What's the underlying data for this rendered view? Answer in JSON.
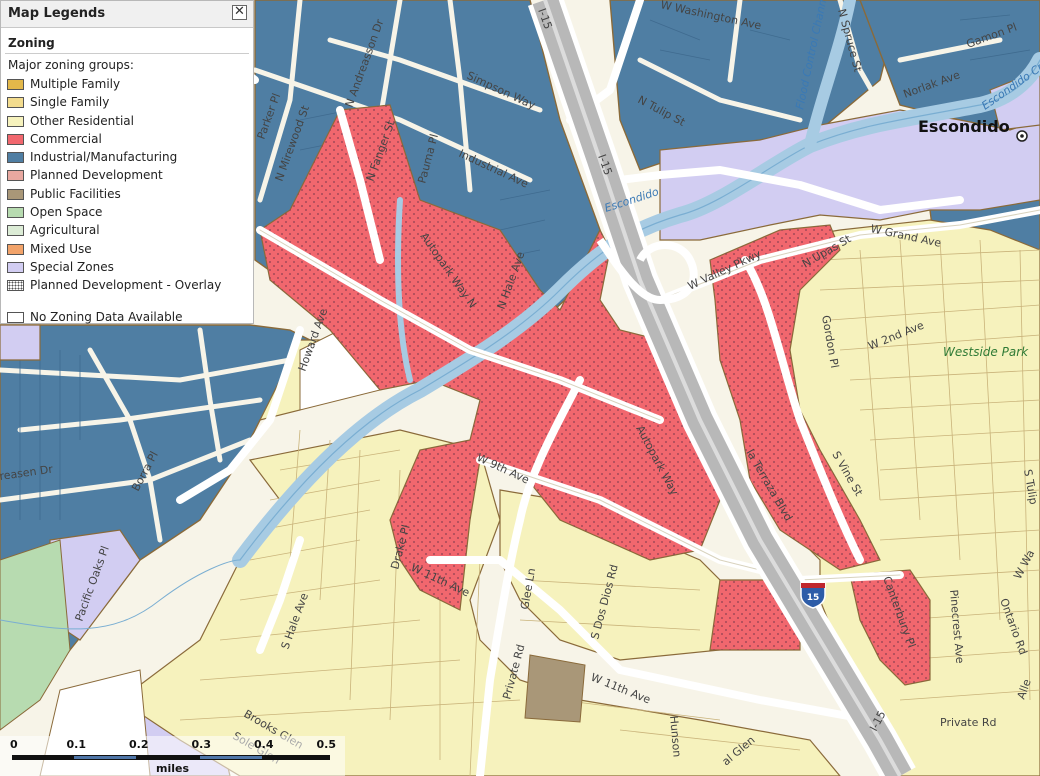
{
  "legend": {
    "title": "Map Legends",
    "close_glyph": "✕",
    "section": "Zoning",
    "subtitle": "Major zoning groups:",
    "items": [
      {
        "label": "Multiple Family",
        "color": "#e3b84a"
      },
      {
        "label": "Single Family",
        "color": "#f3dc8e"
      },
      {
        "label": "Other Residential",
        "color": "#f6f2bd"
      },
      {
        "label": "Commercial",
        "color": "#f1676e"
      },
      {
        "label": "Industrial/Manufacturing",
        "color": "#4f7ea3"
      },
      {
        "label": "Planned Development",
        "color": "#e8a8a0"
      },
      {
        "label": "Public Facilities",
        "color": "#a99778"
      },
      {
        "label": "Open Space",
        "color": "#b7dbb0"
      },
      {
        "label": "Agricultural",
        "color": "#dcecd6"
      },
      {
        "label": "Mixed Use",
        "color": "#f2a36a"
      },
      {
        "label": "Special Zones",
        "color": "#d2cdf2"
      },
      {
        "label": "Planned Development - Overlay",
        "color": "#ffffff"
      },
      {
        "label": "No Zoning Data Available",
        "color": "#ffffff"
      }
    ]
  },
  "map": {
    "city_label": "Escondido",
    "park_label": "Westside Park",
    "water_labels": [
      "Escondido",
      "Flood Control Channel",
      "Escondido Cre"
    ],
    "shield_label": "15",
    "road_labels": {
      "washington": "W Washington Ave",
      "simpson": "Simpson Way",
      "tulip": "N Tulip St",
      "industrial": "Industrial Ave",
      "andreasson": "N Andreasson Dr",
      "parker": "Parker Pl",
      "mirewood": "N Mirewood St",
      "fanger": "N Fanger St",
      "paumaPl": "Pauma Pl",
      "autoparkN": "Autopark Way N",
      "haleN": "N Hale Ave",
      "howard": "Howard Ave",
      "valley": "W Valley Pkwy",
      "grand": "W Grand Ave",
      "upas": "N Upas St",
      "gordon": "Gordon Pl",
      "second": "W 2nd Ave",
      "norlak": "Norlak Ave",
      "spruce": "N Spruce St",
      "gamon": "Gamon Pl",
      "i15a": "I-15",
      "i15b": "I-15",
      "i15c": "I-15",
      "ninth": "W 9th Ave",
      "autopark": "Autopark Way",
      "laTerraza": "la Terraza Blvd",
      "vine": "S Vine St",
      "eleventh1": "W 11th Ave",
      "eleventh2": "W 11th Ave",
      "canterbury": "Canterbury Pl",
      "pinecrest": "Pinecrest Ave",
      "ontario": "Ontario Rd",
      "privateRd1": "Private Rd",
      "privateRd2": "Private Rd",
      "gleeLn": "Glee Ln",
      "sanDiegos": "S Dos Dios Rd",
      "drakePl": "Drake Pl",
      "shale": "S Hale Ave",
      "brooksGlen": "Brooks Glen",
      "soleGlen": "Sole Glen",
      "borra": "Borra Pl",
      "andreasenDr": "reasen Dr",
      "pacificOaks": "Pacific Oaks Pl",
      "andersonTable": "Hunson",
      "glen": "al Glen",
      "tulipFar": "S Tulip",
      "allen": "Alle",
      "wava": "W Wa"
    }
  },
  "scalebar": {
    "ticks": [
      "0",
      "0.1",
      "0.2",
      "0.3",
      "0.4",
      "0.5"
    ],
    "units": "miles"
  }
}
